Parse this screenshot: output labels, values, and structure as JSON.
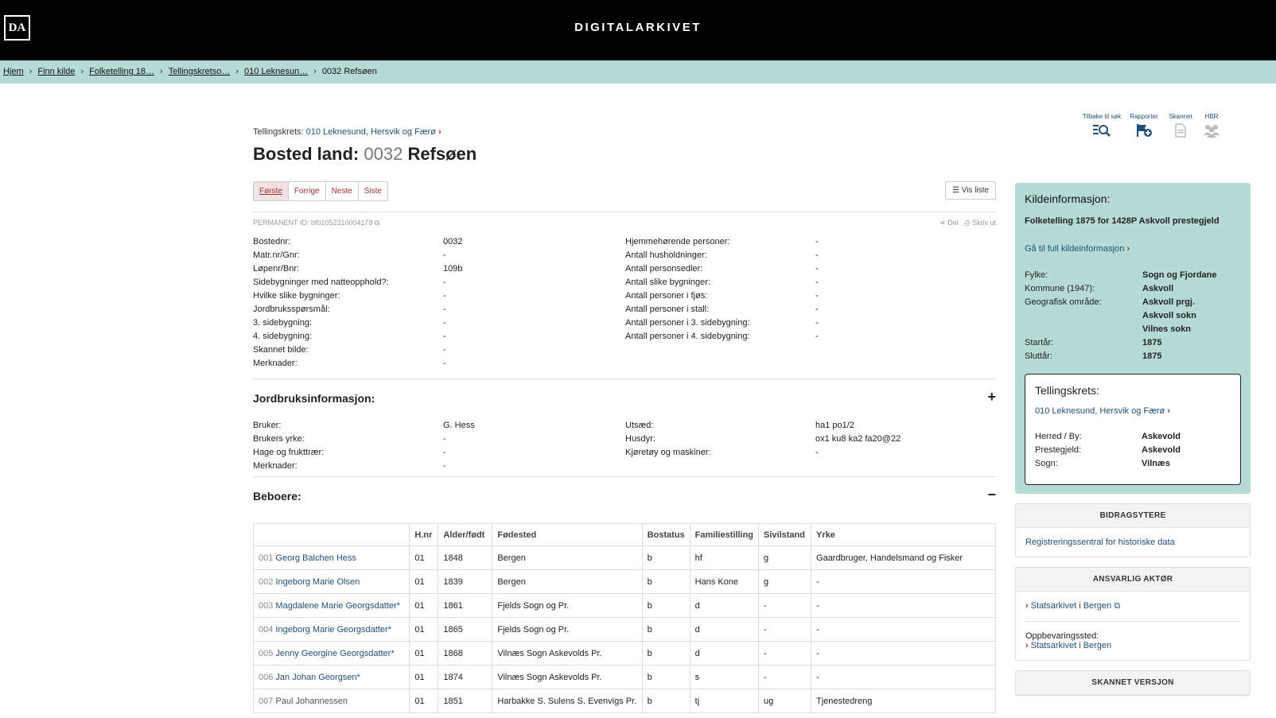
{
  "header": {
    "logo": "DA",
    "brand": "DIGITALARKIVET"
  },
  "breadcrumb": [
    {
      "label": "Hjem",
      "link": true
    },
    {
      "label": "Finn kilde",
      "link": true
    },
    {
      "label": "Folketelling 18…",
      "link": true
    },
    {
      "label": "Tellingskretso…",
      "link": true
    },
    {
      "label": "010 Leknesun…",
      "link": true
    },
    {
      "label": "0032 Refsøen",
      "link": false
    }
  ],
  "toolbar": {
    "back_label": "Tilbake til søk",
    "report_label": "Rapporter",
    "scanned_label": "Skannet",
    "hbr_label": "HBR"
  },
  "main": {
    "tkrets_label": "Tellingskrets:",
    "tkrets_link": "010 Leknesund, Hersvik og Færø",
    "title_prefix": "Bosted land:",
    "title_num": "0032",
    "title_name": "Refsøen",
    "pager": [
      "Første",
      "Forrige",
      "Neste",
      "Siste"
    ],
    "vis_liste": "Vis liste",
    "permanent_id": "PERMANENT ID: bf01052310004178",
    "share_label": "Del",
    "print_label": "Skriv ut"
  },
  "details_left": [
    {
      "k": "Bostednr:",
      "v": "0032"
    },
    {
      "k": "Matr.nr/Gnr:",
      "v": "-"
    },
    {
      "k": "Løpenr/Bnr:",
      "v": "109b"
    },
    {
      "k": "Sidebygninger med natteopphold?:",
      "v": "-"
    },
    {
      "k": "Hvilke slike bygninger:",
      "v": "-"
    },
    {
      "k": "Jordbruksspørsmål:",
      "v": "-"
    },
    {
      "k": "3. sidebygning:",
      "v": "-"
    },
    {
      "k": "4. sidebygning:",
      "v": "-"
    },
    {
      "k": "Skannet bilde:",
      "v": "-"
    },
    {
      "k": "Merknader:",
      "v": "-"
    }
  ],
  "details_right": [
    {
      "k": "Hjemmehørende personer:",
      "v": "-"
    },
    {
      "k": "Antall husholdninger:",
      "v": "-"
    },
    {
      "k": "Antall personsedler:",
      "v": "-"
    },
    {
      "k": "Antall slike bygninger:",
      "v": "-"
    },
    {
      "k": "Antall personer i fjøs:",
      "v": "-"
    },
    {
      "k": "Antall personer i stall:",
      "v": "-"
    },
    {
      "k": "Antall personer i 3. sidebygning:",
      "v": "-"
    },
    {
      "k": "Antall personer i 4. sidebygning:",
      "v": "-"
    }
  ],
  "jordbruk": {
    "heading": "Jordbruksinformasjon:",
    "sign": "+",
    "left": [
      {
        "k": "Bruker:",
        "v": "G. Hess"
      },
      {
        "k": "Brukers yrke:",
        "v": "-"
      },
      {
        "k": "Hage og frukttrær:",
        "v": "-"
      },
      {
        "k": "Merknader:",
        "v": "-"
      }
    ],
    "right": [
      {
        "k": "Utsæd:",
        "v": "ha1 po1/2"
      },
      {
        "k": "Husdyr:",
        "v": "ox1 ku8 ka2 fa20@22"
      },
      {
        "k": "Kjøretøy og maskiner:",
        "v": "-"
      }
    ]
  },
  "beboere": {
    "heading": "Beboere:",
    "sign": "−",
    "columns": [
      "",
      "H.nr",
      "Alder/født",
      "Fødested",
      "Bostatus",
      "Familiestilling",
      "Sivilstand",
      "Yrke"
    ],
    "rows": [
      {
        "no": "001",
        "name": "Georg Balchen Hess",
        "hnr": "01",
        "born": "1848",
        "place": "Bergen",
        "status": "b",
        "family": "hf",
        "civil": "g",
        "job": "Gaardbruger, Handelsmand og Fisker"
      },
      {
        "no": "002",
        "name": "Ingeborg Marie Olsen",
        "hnr": "01",
        "born": "1839",
        "place": "Bergen",
        "status": "b",
        "family": "Hans Kone",
        "civil": "g",
        "job": "-"
      },
      {
        "no": "003",
        "name": "Magdalene Marie Georgsdatter*",
        "hnr": "01",
        "born": "1861",
        "place": "Fjelds Sogn og Pr.",
        "status": "b",
        "family": "d",
        "civil": "-",
        "job": "-"
      },
      {
        "no": "004",
        "name": "Ingeborg Marie Georgsdatter*",
        "hnr": "01",
        "born": "1865",
        "place": "Fjelds Sogn og Pr.",
        "status": "b",
        "family": "d",
        "civil": "-",
        "job": "-"
      },
      {
        "no": "005",
        "name": "Jenny Georgine Georgsdatter*",
        "hnr": "01",
        "born": "1868",
        "place": "Vilnæs Sogn Askevolds Pr.",
        "status": "b",
        "family": "d",
        "civil": "-",
        "job": "-"
      },
      {
        "no": "006",
        "name": "Jan Johan Georgsen*",
        "hnr": "01",
        "born": "1874",
        "place": "Vilnæs Sogn Askevolds Pr.",
        "status": "b",
        "family": "s",
        "civil": "-",
        "job": "-"
      },
      {
        "no": "007",
        "name": "Paul Johannessen",
        "hnr": "01",
        "born": "1851",
        "place": "Harbakke S. Sulens S. Evenvigs Pr.",
        "status": "b",
        "family": "tj",
        "civil": "ug",
        "job": "Tjenestedreng"
      }
    ]
  },
  "kilde": {
    "heading": "Kildeinformasjon:",
    "folketelling": "Folketelling 1875 for 1428P Askvoll prestegjeld",
    "full_link": "Gå til full kildeinformasjon",
    "rows": [
      {
        "k": "Fylke:",
        "v": "Sogn og Fjordane"
      },
      {
        "k": "Kommune (1947):",
        "v": "Askvoll"
      },
      {
        "k": "Geografisk område:",
        "v": "Askvoll prgj."
      },
      {
        "k": "",
        "v": "Askvoll sokn"
      },
      {
        "k": "",
        "v": "Vilnes sokn"
      },
      {
        "k": "Startår:",
        "v": "1875"
      },
      {
        "k": "Sluttår:",
        "v": "1875"
      }
    ],
    "tk_heading": "Tellingskrets:",
    "tk_link": "010 Leknesund, Hersvik og Færø",
    "tk_rows": [
      {
        "k": "Herred / By:",
        "v": "Askevold"
      },
      {
        "k": "Prestegjeld:",
        "v": "Askevold"
      },
      {
        "k": "Sogn:",
        "v": "Vilnæs"
      }
    ]
  },
  "bidrag": {
    "heading": "BIDRAGSYTERE",
    "link": "Registreringssentral for historiske data"
  },
  "ansvarlig": {
    "heading": "ANSVARLIG AKTØR",
    "link": "Statsarkivet i Bergen",
    "oppb_label": "Oppbevaringssted:",
    "oppb_link": "Statsarkivet i Bergen"
  },
  "skannet": {
    "heading": "SKANNET VERSJON"
  }
}
